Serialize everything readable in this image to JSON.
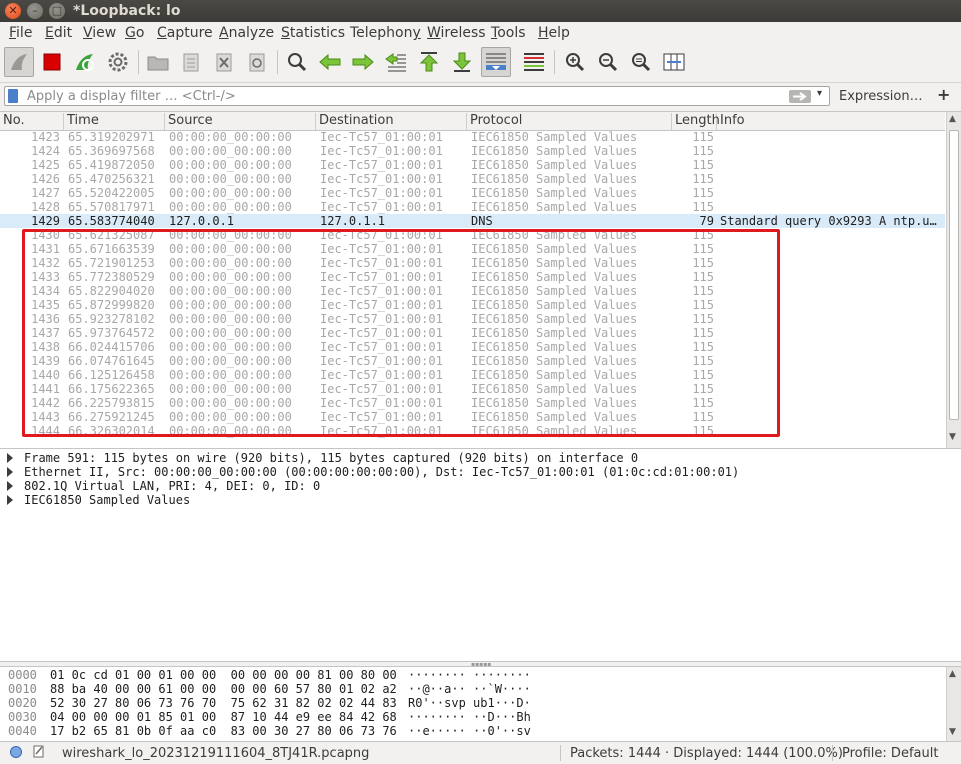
{
  "window": {
    "title": "*Loopback: lo",
    "close_glyph": "✕",
    "min_glyph": "–",
    "max_glyph": "□"
  },
  "menu": [
    {
      "label": "File",
      "u": "F",
      "rest": "ile"
    },
    {
      "label": "Edit",
      "u": "E",
      "rest": "dit"
    },
    {
      "label": "View",
      "u": "V",
      "rest": "iew"
    },
    {
      "label": "Go",
      "u": "G",
      "rest": "o"
    },
    {
      "label": "Capture",
      "u": "C",
      "rest": "apture"
    },
    {
      "label": "Analyze",
      "u": "A",
      "rest": "nalyze"
    },
    {
      "label": "Statistics",
      "u": "S",
      "rest": "tatistics"
    },
    {
      "label": "Telephony",
      "pre": "Telephon",
      "u": "y",
      "rest": ""
    },
    {
      "label": "Wireless",
      "u": "W",
      "rest": "ireless"
    },
    {
      "label": "Tools",
      "u": "T",
      "rest": "ools"
    },
    {
      "label": "Help",
      "u": "H",
      "rest": "elp"
    }
  ],
  "filter": {
    "placeholder": "Apply a display filter … <Ctrl-/>",
    "expression_label": "Expression…",
    "plus_label": "+",
    "dropdown_glyph": "▾"
  },
  "columns": {
    "no": "No.",
    "time": "Time",
    "source": "Source",
    "destination": "Destination",
    "protocol": "Protocol",
    "length": "Length",
    "info": "Info"
  },
  "packets": [
    {
      "no": "1423",
      "time": "65.319202971",
      "src": "00:00:00_00:00:00",
      "dst": "Iec-Tc57_01:00:01",
      "proto": "IEC61850 Sampled Values",
      "len": "115",
      "info": ""
    },
    {
      "no": "1424",
      "time": "65.369697568",
      "src": "00:00:00_00:00:00",
      "dst": "Iec-Tc57_01:00:01",
      "proto": "IEC61850 Sampled Values",
      "len": "115",
      "info": ""
    },
    {
      "no": "1425",
      "time": "65.419872050",
      "src": "00:00:00_00:00:00",
      "dst": "Iec-Tc57_01:00:01",
      "proto": "IEC61850 Sampled Values",
      "len": "115",
      "info": ""
    },
    {
      "no": "1426",
      "time": "65.470256321",
      "src": "00:00:00_00:00:00",
      "dst": "Iec-Tc57_01:00:01",
      "proto": "IEC61850 Sampled Values",
      "len": "115",
      "info": ""
    },
    {
      "no": "1427",
      "time": "65.520422005",
      "src": "00:00:00_00:00:00",
      "dst": "Iec-Tc57_01:00:01",
      "proto": "IEC61850 Sampled Values",
      "len": "115",
      "info": ""
    },
    {
      "no": "1428",
      "time": "65.570817971",
      "src": "00:00:00_00:00:00",
      "dst": "Iec-Tc57_01:00:01",
      "proto": "IEC61850 Sampled Values",
      "len": "115",
      "info": ""
    },
    {
      "no": "1429",
      "time": "65.583774040",
      "src": "127.0.0.1",
      "dst": "127.0.1.1",
      "proto": "DNS",
      "len": "79",
      "info": "Standard query 0x9293 A ntp.u…",
      "selected": true
    },
    {
      "no": "1430",
      "time": "65.621325087",
      "src": "00:00:00_00:00:00",
      "dst": "Iec-Tc57_01:00:01",
      "proto": "IEC61850 Sampled Values",
      "len": "115",
      "info": ""
    },
    {
      "no": "1431",
      "time": "65.671663539",
      "src": "00:00:00_00:00:00",
      "dst": "Iec-Tc57_01:00:01",
      "proto": "IEC61850 Sampled Values",
      "len": "115",
      "info": ""
    },
    {
      "no": "1432",
      "time": "65.721901253",
      "src": "00:00:00_00:00:00",
      "dst": "Iec-Tc57_01:00:01",
      "proto": "IEC61850 Sampled Values",
      "len": "115",
      "info": ""
    },
    {
      "no": "1433",
      "time": "65.772380529",
      "src": "00:00:00_00:00:00",
      "dst": "Iec-Tc57_01:00:01",
      "proto": "IEC61850 Sampled Values",
      "len": "115",
      "info": ""
    },
    {
      "no": "1434",
      "time": "65.822904020",
      "src": "00:00:00_00:00:00",
      "dst": "Iec-Tc57_01:00:01",
      "proto": "IEC61850 Sampled Values",
      "len": "115",
      "info": ""
    },
    {
      "no": "1435",
      "time": "65.872999820",
      "src": "00:00:00_00:00:00",
      "dst": "Iec-Tc57_01:00:01",
      "proto": "IEC61850 Sampled Values",
      "len": "115",
      "info": ""
    },
    {
      "no": "1436",
      "time": "65.923278102",
      "src": "00:00:00_00:00:00",
      "dst": "Iec-Tc57_01:00:01",
      "proto": "IEC61850 Sampled Values",
      "len": "115",
      "info": ""
    },
    {
      "no": "1437",
      "time": "65.973764572",
      "src": "00:00:00_00:00:00",
      "dst": "Iec-Tc57_01:00:01",
      "proto": "IEC61850 Sampled Values",
      "len": "115",
      "info": ""
    },
    {
      "no": "1438",
      "time": "66.024415706",
      "src": "00:00:00_00:00:00",
      "dst": "Iec-Tc57_01:00:01",
      "proto": "IEC61850 Sampled Values",
      "len": "115",
      "info": ""
    },
    {
      "no": "1439",
      "time": "66.074761645",
      "src": "00:00:00_00:00:00",
      "dst": "Iec-Tc57_01:00:01",
      "proto": "IEC61850 Sampled Values",
      "len": "115",
      "info": ""
    },
    {
      "no": "1440",
      "time": "66.125126458",
      "src": "00:00:00_00:00:00",
      "dst": "Iec-Tc57_01:00:01",
      "proto": "IEC61850 Sampled Values",
      "len": "115",
      "info": ""
    },
    {
      "no": "1441",
      "time": "66.175622365",
      "src": "00:00:00_00:00:00",
      "dst": "Iec-Tc57_01:00:01",
      "proto": "IEC61850 Sampled Values",
      "len": "115",
      "info": ""
    },
    {
      "no": "1442",
      "time": "66.225793815",
      "src": "00:00:00_00:00:00",
      "dst": "Iec-Tc57_01:00:01",
      "proto": "IEC61850 Sampled Values",
      "len": "115",
      "info": ""
    },
    {
      "no": "1443",
      "time": "66.275921245",
      "src": "00:00:00_00:00:00",
      "dst": "Iec-Tc57_01:00:01",
      "proto": "IEC61850 Sampled Values",
      "len": "115",
      "info": ""
    },
    {
      "no": "1444",
      "time": "66.326302014",
      "src": "00:00:00_00:00:00",
      "dst": "Iec-Tc57_01:00:01",
      "proto": "IEC61850 Sampled Values",
      "len": "115",
      "info": ""
    }
  ],
  "details": [
    "Frame 591: 115 bytes on wire (920 bits), 115 bytes captured (920 bits) on interface 0",
    "Ethernet II, Src: 00:00:00_00:00:00 (00:00:00:00:00:00), Dst: Iec-Tc57_01:00:01 (01:0c:cd:01:00:01)",
    "802.1Q Virtual LAN, PRI: 4, DEI: 0, ID: 0",
    "IEC61850 Sampled Values"
  ],
  "bytes": [
    {
      "off": "0000",
      "hex": "01 0c cd 01 00 01 00 00  00 00 00 00 81 00 80 00",
      "asc": "········ ········"
    },
    {
      "off": "0010",
      "hex": "88 ba 40 00 00 61 00 00  00 00 60 57 80 01 02 a2",
      "asc": "··@··a·· ··`W····"
    },
    {
      "off": "0020",
      "hex": "52 30 27 80 06 73 76 70  75 62 31 82 02 02 44 83",
      "asc": "R0'··svp ub1···D·"
    },
    {
      "off": "0030",
      "hex": "04 00 00 00 01 85 01 00  87 10 44 e9 ee 84 42 68",
      "asc": "········ ··D···Bh"
    },
    {
      "off": "0040",
      "hex": "17 b2 65 81 0b 0f aa c0  83 00 30 27 80 06 73 76",
      "asc": "··e····· ··0'··sv"
    }
  ],
  "status": {
    "file": "wireshark_lo_20231219111604_8TJ41R.pcapng",
    "packets": "Packets: 1444 · Displayed: 1444 (100.0%)",
    "profile": "Profile: Default"
  },
  "colors": {
    "selected_row": "#d9ebf9",
    "highlight_box": "#e0191e",
    "dimmed_text": "#a8a8a8"
  }
}
